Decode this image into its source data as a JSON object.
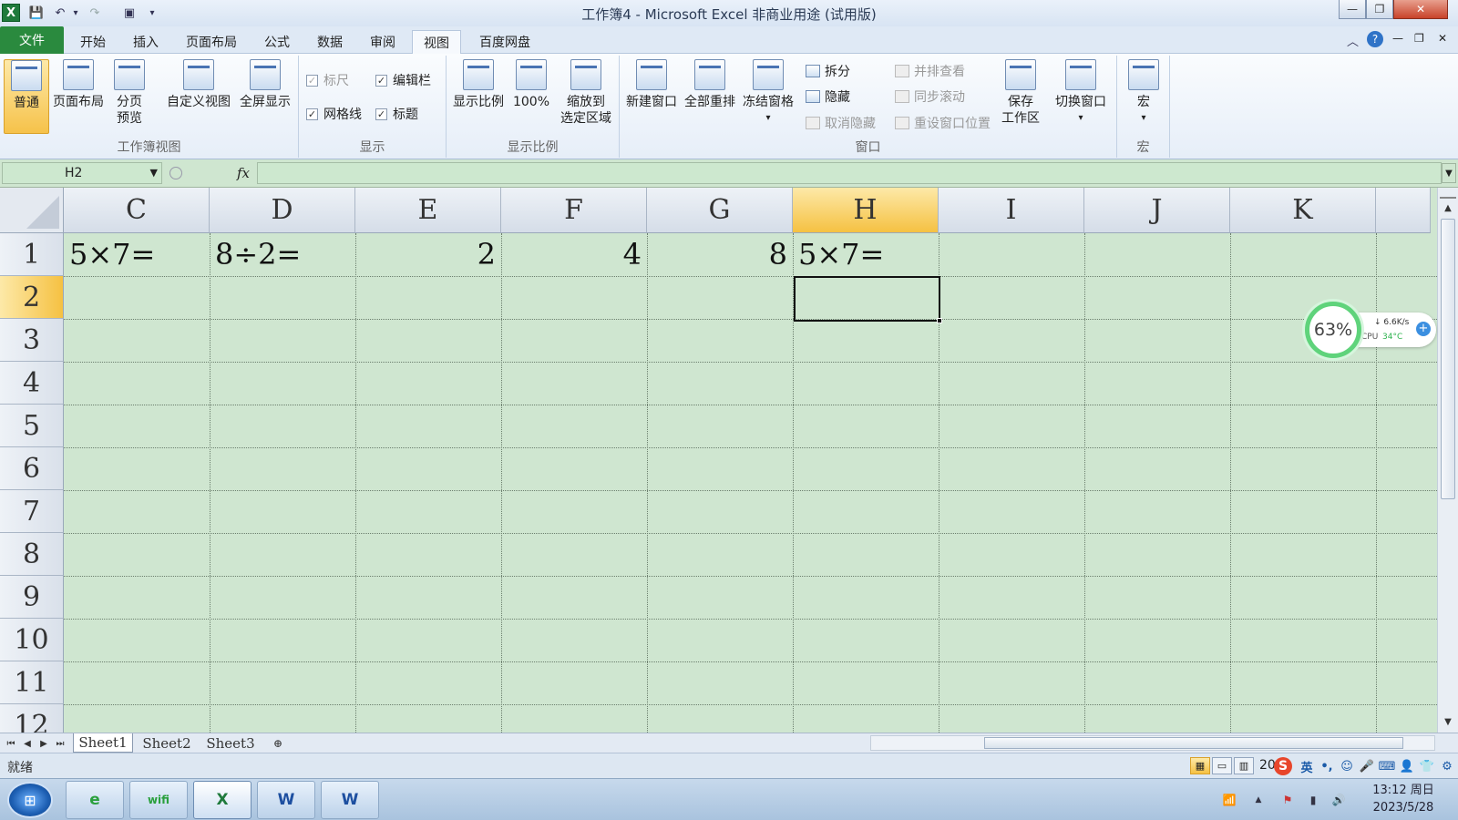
{
  "window": {
    "title": "工作簿4 - Microsoft Excel 非商业用途 (试用版)",
    "app_icon": "X",
    "qat": {
      "save": "💾",
      "undo": "↶",
      "redo": "↷",
      "customize": "▾",
      "print_preview": "▣"
    },
    "buttons": {
      "minimize": "—",
      "restore": "❐",
      "close": "✕"
    }
  },
  "tabs": [
    "文件",
    "开始",
    "插入",
    "页面布局",
    "公式",
    "数据",
    "审阅",
    "视图",
    "百度网盘"
  ],
  "active_tab": "视图",
  "ribbon_controls": {
    "minimize_ribbon": "︿",
    "help": "?",
    "min": "—",
    "restore": "❐",
    "close": "✕"
  },
  "ribbon": {
    "workbook_views": {
      "label": "工作簿视图",
      "normal": "普通",
      "page_layout": "页面布局",
      "page_break_preview_1": "分页",
      "page_break_preview_2": "预览",
      "custom_views": "自定义视图",
      "full_screen": "全屏显示"
    },
    "show": {
      "label": "显示",
      "ruler": "标尺",
      "formula_bar": "编辑栏",
      "gridlines": "网格线",
      "headings": "标题",
      "check": "✓"
    },
    "zoom": {
      "label": "显示比例",
      "zoom": "显示比例",
      "hundred": "100%",
      "zoom_selection_1": "缩放到",
      "zoom_selection_2": "选定区域"
    },
    "window": {
      "label": "窗口",
      "new_window": "新建窗口",
      "arrange_all": "全部重排",
      "freeze_panes": "冻结窗格",
      "split": "拆分",
      "hide": "隐藏",
      "unhide": "取消隐藏",
      "side_by_side": "并排查看",
      "sync_scroll": "同步滚动",
      "reset_position": "重设窗口位置",
      "save_workspace_1": "保存",
      "save_workspace_2": "工作区",
      "switch_windows": "切换窗口",
      "dropdown": "▾"
    },
    "macros": {
      "label": "宏",
      "macros": "宏"
    }
  },
  "formula_bar": {
    "name_box": "H2",
    "fx": "fx",
    "formula": ""
  },
  "columns": [
    "C",
    "D",
    "E",
    "F",
    "G",
    "H",
    "I",
    "J",
    "K"
  ],
  "rows": [
    "1",
    "2",
    "3",
    "4",
    "5",
    "6",
    "7",
    "8",
    "9",
    "10",
    "11",
    "12"
  ],
  "selected_cell": "H2",
  "cells": {
    "C1": "5×7=",
    "D1": "8÷2=",
    "E1": "2",
    "F1": "4",
    "G1": "8",
    "H1": "5×7="
  },
  "cpu_widget": {
    "percent": "63%",
    "net_speed": "↓ 6.6K/s",
    "cpu_label": "CPU",
    "cpu_temp": "34°C",
    "plus": "+"
  },
  "sheets": [
    "Sheet1",
    "Sheet2",
    "Sheet3"
  ],
  "active_sheet": "Sheet1",
  "sheet_nav": [
    "⏮",
    "◀",
    "▶",
    "⏭"
  ],
  "status": {
    "ready": "就绪",
    "zoom_partial": "20"
  },
  "ime": {
    "logo": "S",
    "lang": "英",
    "punct": "•,",
    "emoji": "☺",
    "mic": "🎤",
    "keyboard": "⌨",
    "user": "👤",
    "shirt": "👕",
    "tools": "⚙"
  },
  "taskbar": {
    "start": "⊞",
    "apps": [
      "e",
      "wifi",
      "X",
      "W",
      "W"
    ],
    "time": "13:12 周日",
    "date": "2023/5/28"
  },
  "tray": {
    "network": "📶",
    "up": "▲",
    "flag": "⚑",
    "signal": "▮",
    "volume": "🔊"
  },
  "colors": {
    "grid_bg": "#cfe6d0",
    "selected_header": "#f5c142",
    "file_tab": "#2a8a3e"
  }
}
